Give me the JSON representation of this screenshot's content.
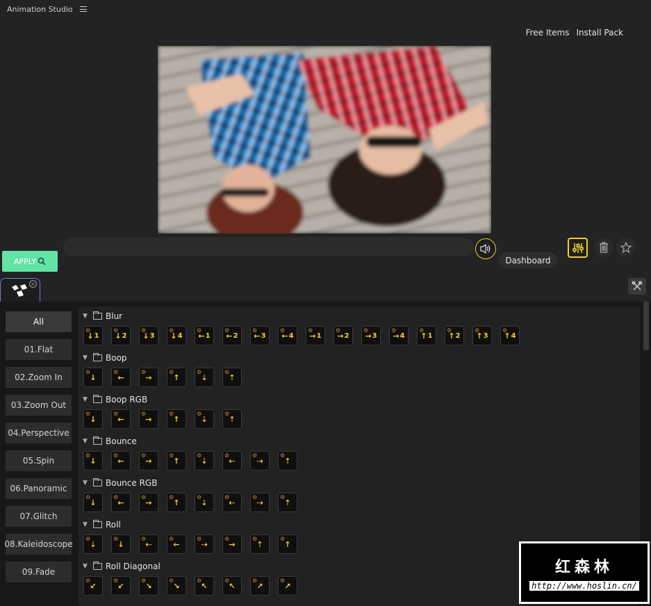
{
  "window": {
    "title": "Animation Studio"
  },
  "top_links": {
    "free_items": "Free Items",
    "install_pack": "Install Pack"
  },
  "toolbar": {
    "apply_label": "APPLY",
    "dashboard_tooltip": "Dashboard"
  },
  "categories": [
    {
      "label": "All",
      "active": true
    },
    {
      "label": "01.Flat"
    },
    {
      "label": "02.Zoom In"
    },
    {
      "label": "03.Zoom Out"
    },
    {
      "label": "04.Perspective"
    },
    {
      "label": "05.Spin"
    },
    {
      "label": "06.Panoramic"
    },
    {
      "label": "07.Glitch"
    },
    {
      "label": "08.Kaleidoscope"
    },
    {
      "label": "09.Fade"
    }
  ],
  "groups": [
    {
      "name": "Blur",
      "items": [
        {
          "glyph": "↓",
          "num": "1"
        },
        {
          "glyph": "↓",
          "num": "2"
        },
        {
          "glyph": "↓",
          "num": "3"
        },
        {
          "glyph": "↓",
          "num": "4"
        },
        {
          "glyph": "←",
          "num": "1"
        },
        {
          "glyph": "←",
          "num": "2"
        },
        {
          "glyph": "←",
          "num": "3"
        },
        {
          "glyph": "←",
          "num": "4"
        },
        {
          "glyph": "→",
          "num": "1"
        },
        {
          "glyph": "→",
          "num": "2"
        },
        {
          "glyph": "→",
          "num": "3"
        },
        {
          "glyph": "→",
          "num": "4"
        },
        {
          "glyph": "↑",
          "num": "1"
        },
        {
          "glyph": "↑",
          "num": "2"
        },
        {
          "glyph": "↑",
          "num": "3"
        },
        {
          "glyph": "↑",
          "num": "4"
        }
      ]
    },
    {
      "name": "Boop",
      "items": [
        {
          "glyph": "↓"
        },
        {
          "glyph": "←"
        },
        {
          "glyph": "→"
        },
        {
          "glyph": "↑"
        },
        {
          "glyph": "⇣"
        },
        {
          "glyph": "⇡"
        }
      ]
    },
    {
      "name": "Boop RGB",
      "items": [
        {
          "glyph": "↓"
        },
        {
          "glyph": "←"
        },
        {
          "glyph": "→"
        },
        {
          "glyph": "↑"
        },
        {
          "glyph": "⇣"
        },
        {
          "glyph": "⇡"
        }
      ]
    },
    {
      "name": "Bounce",
      "items": [
        {
          "glyph": "↓"
        },
        {
          "glyph": "←"
        },
        {
          "glyph": "→"
        },
        {
          "glyph": "↑"
        },
        {
          "glyph": "⇣"
        },
        {
          "glyph": "⇠"
        },
        {
          "glyph": "⇢"
        },
        {
          "glyph": "⇡"
        }
      ]
    },
    {
      "name": "Bounce RGB",
      "items": [
        {
          "glyph": "↓"
        },
        {
          "glyph": "←"
        },
        {
          "glyph": "→"
        },
        {
          "glyph": "↑"
        },
        {
          "glyph": "⇣"
        },
        {
          "glyph": "⇠"
        },
        {
          "glyph": "⇢"
        },
        {
          "glyph": "⇡"
        }
      ]
    },
    {
      "name": "Roll",
      "items": [
        {
          "glyph": "⇣"
        },
        {
          "glyph": "↓"
        },
        {
          "glyph": "⇠"
        },
        {
          "glyph": "←"
        },
        {
          "glyph": "⇢"
        },
        {
          "glyph": "→"
        },
        {
          "glyph": "⇡"
        },
        {
          "glyph": "↑"
        }
      ]
    },
    {
      "name": "Roll Diagonal",
      "items": [
        {
          "glyph": "↙"
        },
        {
          "glyph": "↙"
        },
        {
          "glyph": "↘"
        },
        {
          "glyph": "↘"
        },
        {
          "glyph": "↖"
        },
        {
          "glyph": "↖"
        },
        {
          "glyph": "↗"
        },
        {
          "glyph": "↗"
        }
      ]
    }
  ],
  "watermark": {
    "text": "红森林",
    "url": "http://www.hoslin.cn/"
  },
  "colors": {
    "accent_yellow": "#f4d21f",
    "apply_green": "#63e3a6",
    "tab_border": "#6f7fd8"
  }
}
